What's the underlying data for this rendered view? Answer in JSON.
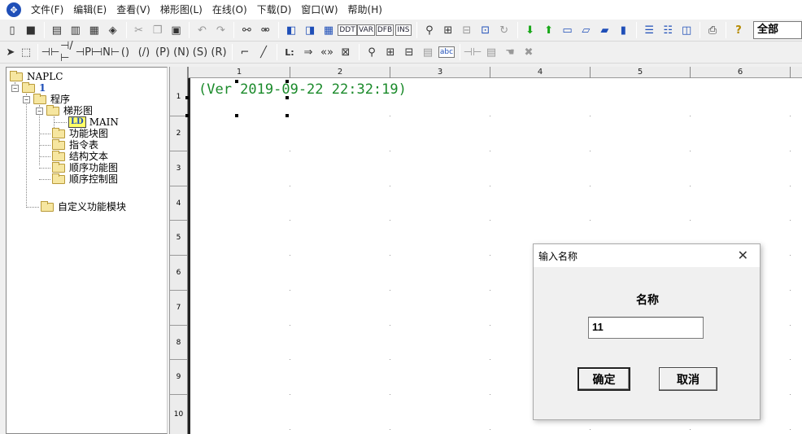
{
  "menubar": {
    "items": [
      "文件(F)",
      "编辑(E)",
      "查看(V)",
      "梯形图(L)",
      "在线(O)",
      "下载(D)",
      "窗口(W)",
      "帮助(H)"
    ]
  },
  "toolbar1": {
    "icons": [
      "new-icon",
      "save-icon",
      "doc-icon",
      "doc2-icon",
      "open-icon",
      "print-preview-icon",
      "cut-icon",
      "copy-icon",
      "paste-icon",
      "undo-icon",
      "redo-icon",
      "binoculars-icon",
      "find-replace-icon",
      "window-icon",
      "window2-icon",
      "grid-icon",
      "ddt-icon",
      "var-icon",
      "dfb-icon",
      "ins-icon",
      "search-icon",
      "network-icon",
      "network2-icon",
      "print-setup-icon",
      "refresh-icon",
      "download-icon",
      "upload-icon",
      "file-icon",
      "file2-icon",
      "file3-icon",
      "file4-icon",
      "layout-icon",
      "layout2-icon",
      "layout3-icon",
      "printer-icon",
      "help-icon"
    ],
    "combo_value": "全部"
  },
  "toolbar2": {
    "labels": {
      "abc": "abc",
      "l": "L:"
    }
  },
  "tree": {
    "root": "NAPLC",
    "project": "1",
    "program": "程序",
    "ladder": "梯形图",
    "main_badge": "LD",
    "main": "MAIN",
    "items": [
      "功能块图",
      "指令表",
      "结构文本",
      "顺序功能图",
      "顺序控制图"
    ],
    "custom": "自定义功能模块"
  },
  "editor": {
    "columns": [
      "1",
      "2",
      "3",
      "4",
      "5",
      "6"
    ],
    "rows": [
      "1",
      "2",
      "3",
      "4",
      "5",
      "6",
      "7",
      "8",
      "9",
      "10"
    ],
    "version_text": "(Ver 2019-09-22 22:32:19)"
  },
  "dialog": {
    "title": "输入名称",
    "close": "✕",
    "label": "名称",
    "input_value": "11",
    "ok": "确定",
    "cancel": "取消"
  }
}
